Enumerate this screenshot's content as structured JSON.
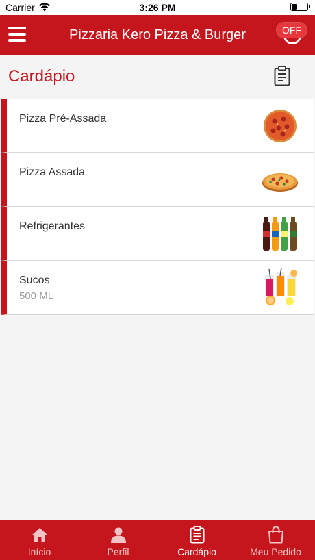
{
  "status_bar": {
    "carrier": "Carrier",
    "time": "3:26 PM"
  },
  "header": {
    "title": "Pizzaria Kero Pizza & Burger",
    "status_badge": "OFF"
  },
  "section": {
    "title": "Cardápio"
  },
  "menu": [
    {
      "name": "Pizza Pré-Assada",
      "subtitle": "",
      "thumbnail": "pepperoni-pizza-icon"
    },
    {
      "name": "Pizza Assada",
      "subtitle": "",
      "thumbnail": "baked-pizza-icon"
    },
    {
      "name": "Refrigerantes",
      "subtitle": "",
      "thumbnail": "soda-bottles-icon"
    },
    {
      "name": "Sucos",
      "subtitle": "500 ML",
      "thumbnail": "juice-glasses-icon"
    }
  ],
  "tabs": [
    {
      "label": "Início",
      "icon": "home-icon",
      "active": false
    },
    {
      "label": "Perfil",
      "icon": "user-icon",
      "active": false
    },
    {
      "label": "Cardápio",
      "icon": "clipboard-icon",
      "active": true
    },
    {
      "label": "Meu Pedido",
      "icon": "shopping-bag-icon",
      "active": false
    }
  ],
  "colors": {
    "brand_red": "#c4161c",
    "badge_red": "#e8383d",
    "background": "#f4f4f4"
  }
}
